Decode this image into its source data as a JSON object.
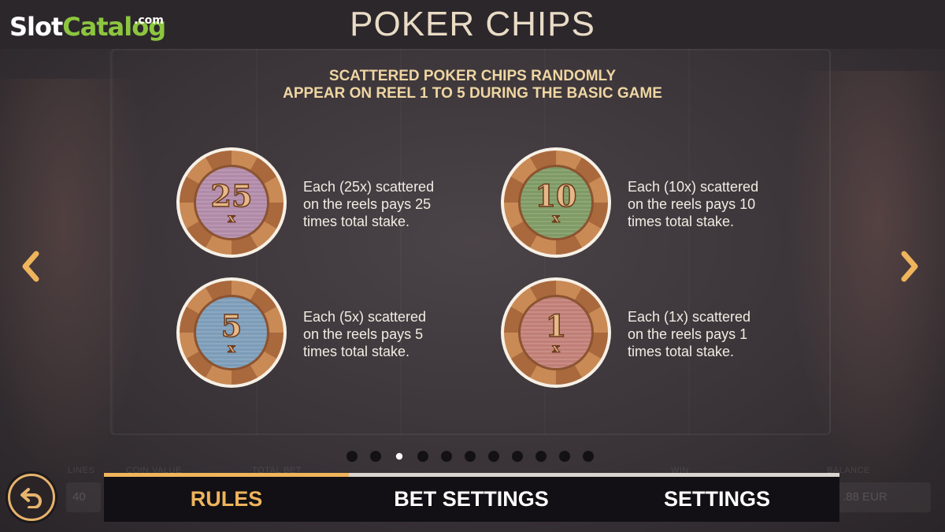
{
  "brand": {
    "slot": "Slot",
    "catalog": "Catalog",
    "com": ".com"
  },
  "page": {
    "title": "POKER CHIPS"
  },
  "intro": {
    "line1": "SCATTERED POKER CHIPS RANDOMLY",
    "line2": "APPEAR ON REEL 1 TO 5 DURING THE BASIC GAME"
  },
  "chips": [
    {
      "value": "25",
      "x": "x",
      "center_color": "#b08aa8",
      "desc": [
        "Each (25x) scattered",
        "on the reels pays 25",
        "times total stake."
      ]
    },
    {
      "value": "10",
      "x": "x",
      "center_color": "#7f9a64",
      "desc": [
        "Each (10x) scattered",
        "on the reels pays 10",
        "times total stake."
      ]
    },
    {
      "value": "5",
      "x": "x",
      "center_color": "#7c9cb8",
      "desc": [
        "Each (5x) scattered",
        "on the reels pays 5",
        "times total stake."
      ]
    },
    {
      "value": "1",
      "x": "x",
      "center_color": "#c07e76",
      "desc": [
        "Each (1x) scattered",
        "on the reels pays 1",
        "times total stake."
      ]
    }
  ],
  "navigation": {
    "prev_icon": "chevron-left-icon",
    "next_icon": "chevron-right-icon",
    "arrow_color": "#efb45c",
    "page_dots": 11,
    "active_page": 3
  },
  "background_bar": {
    "labels": [
      "LINES",
      "COIN VALUE",
      "TOTAL BET",
      "WIN",
      "BALANCE"
    ],
    "lines_value": "40",
    "balance_value": ".88 EUR"
  },
  "tabs": [
    {
      "label": "RULES",
      "active": true
    },
    {
      "label": "BET SETTINGS",
      "active": false
    },
    {
      "label": "SETTINGS",
      "active": false
    }
  ],
  "back_icon": "back-arrow-icon",
  "colors": {
    "accent": "#efb45c",
    "header_bg": "#2c272b",
    "tab_bg": "#121014",
    "brand_green": "#8cc63f"
  }
}
